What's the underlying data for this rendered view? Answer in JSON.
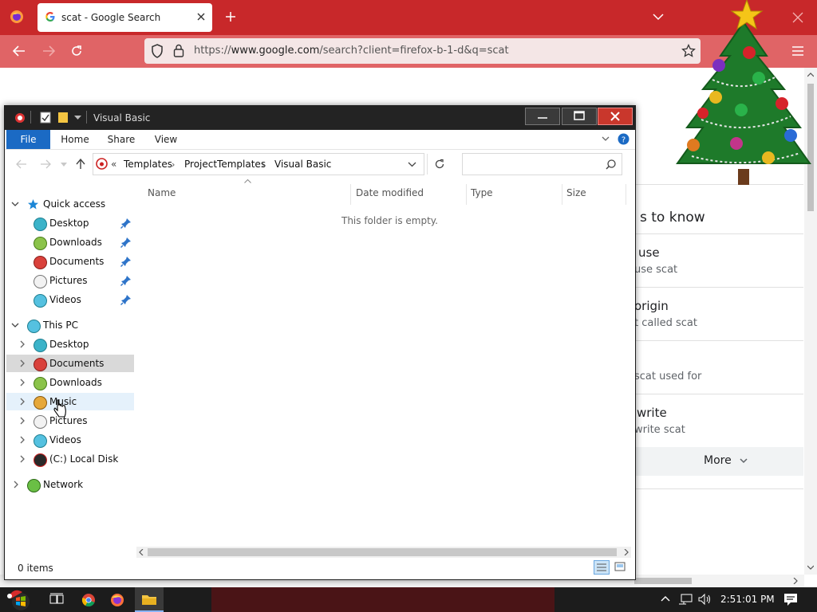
{
  "browser": {
    "tab_title": "scat - Google Search",
    "url_prefix": "https://",
    "url_host": "www.google.com",
    "url_rest": "/search?client=firefox-b-1-d&q=scat"
  },
  "google": {
    "section_heading_fragment": "s to know",
    "items": [
      {
        "title": "use",
        "sub": "use scat"
      },
      {
        "title": "origin",
        "sub": "t called scat"
      },
      {
        "title": "",
        "sub": "scat used for"
      },
      {
        "title": "write",
        "sub": "write scat"
      }
    ],
    "more_label": "More"
  },
  "explorer": {
    "title": "Visual Basic",
    "ribbon_tabs": [
      "File",
      "Home",
      "Share",
      "View"
    ],
    "breadcrumb_prefix": "«",
    "breadcrumb": [
      "Templates",
      "ProjectTemplates",
      "Visual Basic"
    ],
    "search_placeholder": "",
    "columns": [
      "Name",
      "Date modified",
      "Type",
      "Size"
    ],
    "empty_message": "This folder is empty.",
    "status": "0 items",
    "nav": {
      "quick_access": "Quick access",
      "quick_items": [
        "Desktop",
        "Downloads",
        "Documents",
        "Pictures",
        "Videos"
      ],
      "this_pc": "This PC",
      "pc_items": [
        "Desktop",
        "Documents",
        "Downloads",
        "Music",
        "Pictures",
        "Videos",
        "(C:) Local Disk"
      ],
      "network": "Network"
    }
  },
  "taskbar": {
    "clock": "2:51:01 PM"
  },
  "colors": {
    "firefox_tabbar": "#c8282a",
    "firefox_navbar": "#e06466",
    "explorer_file_tab": "#1b6ac4",
    "nav_selected": "#d9d9d9",
    "nav_hover": "#e5f1fb"
  }
}
